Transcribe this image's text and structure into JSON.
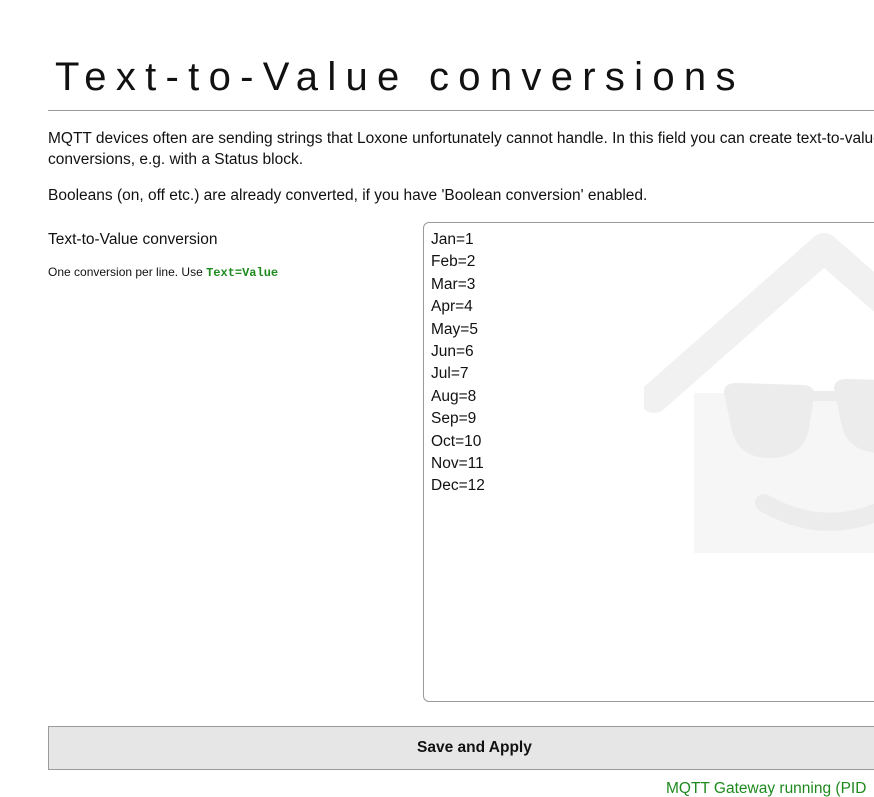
{
  "page": {
    "title": "Text-to-Value conversions"
  },
  "intro": {
    "paragraph1": "MQTT devices often are sending strings that Loxone unfortunately cannot handle. In this field you can create text-to-value conversions, e.g. with a Status block.",
    "paragraph2": "Booleans (on, off etc.) are already converted, if you have 'Boolean conversion' enabled."
  },
  "conversion_field": {
    "label": "Text-to-Value conversion",
    "hint_text": "One conversion per line. Use ",
    "hint_code": "Text=Value",
    "value": "Jan=1\nFeb=2\nMar=3\nApr=4\nMay=5\nJun=6\nJul=7\nAug=8\nSep=9\nOct=10\nNov=11\nDec=12",
    "watermark_icon": "loxberry-house-sunglasses-icon"
  },
  "actions": {
    "save_label": "Save and Apply"
  },
  "status": {
    "text": "MQTT Gateway running (PID"
  },
  "colors": {
    "accent_green": "#1e8a1e",
    "button_bg": "#e6e6e6",
    "border": "#9a9a9a"
  }
}
